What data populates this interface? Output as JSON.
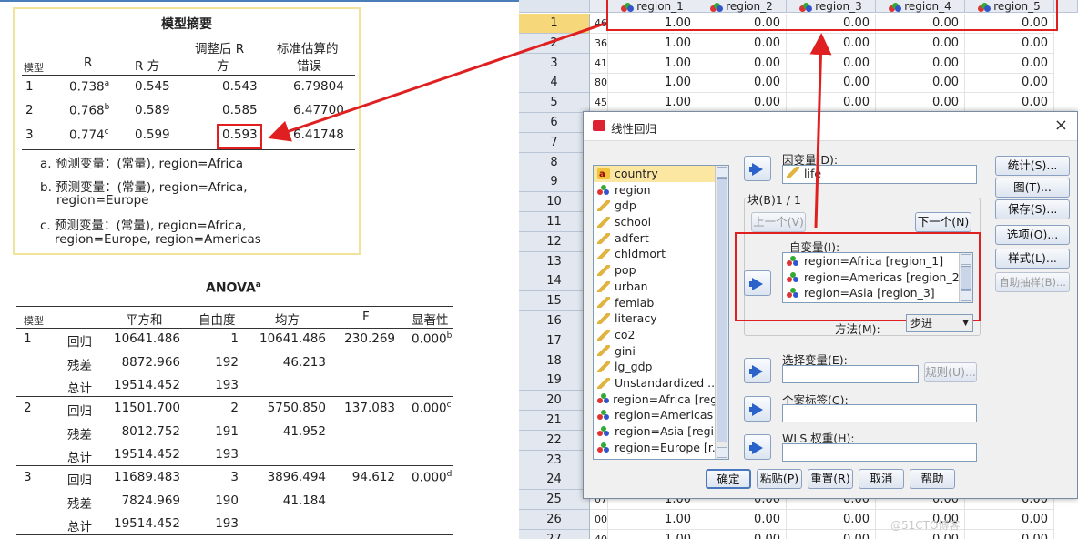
{
  "model_summary": {
    "title": "模型摘要",
    "headers": {
      "model": "模型",
      "r": "R",
      "r2": "R 方",
      "adj_r2_l1": "调整后 R",
      "adj_r2_l2": "方",
      "se_l1": "标准估算的",
      "se_l2": "错误"
    },
    "rows": [
      {
        "model": "1",
        "r": "0.738",
        "sup": "a",
        "r2": "0.545",
        "adj": "0.543",
        "se": "6.79804"
      },
      {
        "model": "2",
        "r": "0.768",
        "sup": "b",
        "r2": "0.589",
        "adj": "0.585",
        "se": "6.47700"
      },
      {
        "model": "3",
        "r": "0.774",
        "sup": "c",
        "r2": "0.599",
        "adj": "0.593",
        "se": "6.41748"
      }
    ],
    "notes": [
      "a. 预测变量：(常量), region=Africa",
      "b. 预测变量：(常量), region=Africa,",
      "region=Europe",
      "c. 预测变量：(常量), region=Africa,",
      "region=Europe, region=Americas"
    ]
  },
  "anova": {
    "title": "ANOVA",
    "title_sup": "a",
    "headers": {
      "model": "模型",
      "ss": "平方和",
      "df": "自由度",
      "ms": "均方",
      "f": "F",
      "sig": "显著性"
    },
    "blocks": [
      {
        "model": "1",
        "rows": [
          {
            "src": "回归",
            "ss": "10641.486",
            "df": "1",
            "ms": "10641.486",
            "f": "230.269",
            "sig": "0.000",
            "sup": "b"
          },
          {
            "src": "残差",
            "ss": "8872.966",
            "df": "192",
            "ms": "46.213"
          },
          {
            "src": "总计",
            "ss": "19514.452",
            "df": "193"
          }
        ]
      },
      {
        "model": "2",
        "rows": [
          {
            "src": "回归",
            "ss": "11501.700",
            "df": "2",
            "ms": "5750.850",
            "f": "137.083",
            "sig": "0.000",
            "sup": "c"
          },
          {
            "src": "残差",
            "ss": "8012.752",
            "df": "191",
            "ms": "41.952"
          },
          {
            "src": "总计",
            "ss": "19514.452",
            "df": "193"
          }
        ]
      },
      {
        "model": "3",
        "rows": [
          {
            "src": "回归",
            "ss": "11689.483",
            "df": "3",
            "ms": "3896.494",
            "f": "94.612",
            "sig": "0.000",
            "sup": "d"
          },
          {
            "src": "残差",
            "ss": "7824.969",
            "df": "190",
            "ms": "41.184"
          },
          {
            "src": "总计",
            "ss": "19514.452",
            "df": "193"
          }
        ]
      }
    ]
  },
  "datagrid": {
    "columns": [
      "region_1",
      "region_2",
      "region_3",
      "region_4",
      "region_5"
    ],
    "row_numbers": [
      "1",
      "2",
      "3",
      "4",
      "5",
      "6",
      "7",
      "8",
      "9",
      "10",
      "11",
      "12",
      "13",
      "14",
      "15",
      "16",
      "17",
      "18",
      "19",
      "20",
      "21",
      "22",
      "23",
      "24",
      "25",
      "26",
      "27"
    ],
    "partial_col": [
      "46",
      "36",
      "41",
      "80",
      "45"
    ],
    "rows_top": [
      [
        "1.00",
        "0.00",
        "0.00",
        "0.00",
        "0.00"
      ],
      [
        "1.00",
        "0.00",
        "0.00",
        "0.00",
        "0.00"
      ],
      [
        "1.00",
        "0.00",
        "0.00",
        "0.00",
        "0.00"
      ],
      [
        "1.00",
        "0.00",
        "0.00",
        "0.00",
        "0.00"
      ],
      [
        "1.00",
        "0.00",
        "0.00",
        "0.00",
        "0.00"
      ]
    ],
    "rows_bottom": [
      {
        "partial": "07",
        "vals": [
          "1.00",
          "0.00",
          "0.00",
          "0.00",
          "0.00"
        ]
      },
      {
        "partial": "00",
        "vals": [
          "1.00",
          "0.00",
          "0.00",
          "0.00",
          "0.00"
        ]
      },
      {
        "partial": "40",
        "vals": [
          "1.00",
          "0.00",
          "0.00",
          "0.00",
          "0.00"
        ]
      }
    ]
  },
  "dialog": {
    "title": "线性回归",
    "dep_label": "因变量(D):",
    "dep_value": "life",
    "block_label": "块(B)1 / 1",
    "prev_btn": "上一个(V)",
    "next_btn": "下一个(N)",
    "indep_label": "自变量(I):",
    "indep_items": [
      "region=Africa [region_1]",
      "region=Americas [region_2]",
      "region=Asia [region_3]"
    ],
    "method_label": "方法(M):",
    "method_value": "步进",
    "select_label": "选择变量(E):",
    "rule_btn": "规则(U)...",
    "case_label": "个案标签(C):",
    "wls_label": "WLS 权重(H):",
    "vars": [
      {
        "name": "country",
        "type": "str"
      },
      {
        "name": "region",
        "type": "nom"
      },
      {
        "name": "gdp",
        "type": "ruler"
      },
      {
        "name": "school",
        "type": "ruler"
      },
      {
        "name": "adfert",
        "type": "ruler"
      },
      {
        "name": "chldmort",
        "type": "ruler"
      },
      {
        "name": "pop",
        "type": "ruler"
      },
      {
        "name": "urban",
        "type": "ruler"
      },
      {
        "name": "femlab",
        "type": "ruler"
      },
      {
        "name": "literacy",
        "type": "ruler"
      },
      {
        "name": "co2",
        "type": "ruler"
      },
      {
        "name": "gini",
        "type": "ruler"
      },
      {
        "name": "lg_gdp",
        "type": "ruler"
      },
      {
        "name": "Unstandardized ...",
        "type": "ruler"
      },
      {
        "name": "region=Africa [reg...",
        "type": "nom"
      },
      {
        "name": "region=Americas ...",
        "type": "nom"
      },
      {
        "name": "region=Asia [regi...",
        "type": "nom"
      },
      {
        "name": "region=Europe [r...",
        "type": "nom"
      }
    ],
    "side_buttons": [
      "统计(S)...",
      "图(T)...",
      "保存(S)...",
      "选项(O)...",
      "样式(L)...",
      "自助抽样(B)..."
    ],
    "bottom_buttons": [
      "确定",
      "粘贴(P)",
      "重置(R)",
      "取消",
      "帮助"
    ],
    "close_icon": "×"
  },
  "watermark": "@51CTO博客",
  "colors": {
    "accent_red": "#e02020",
    "highlight": "#fbe6a2",
    "grid_header": "#e3e8f0"
  }
}
